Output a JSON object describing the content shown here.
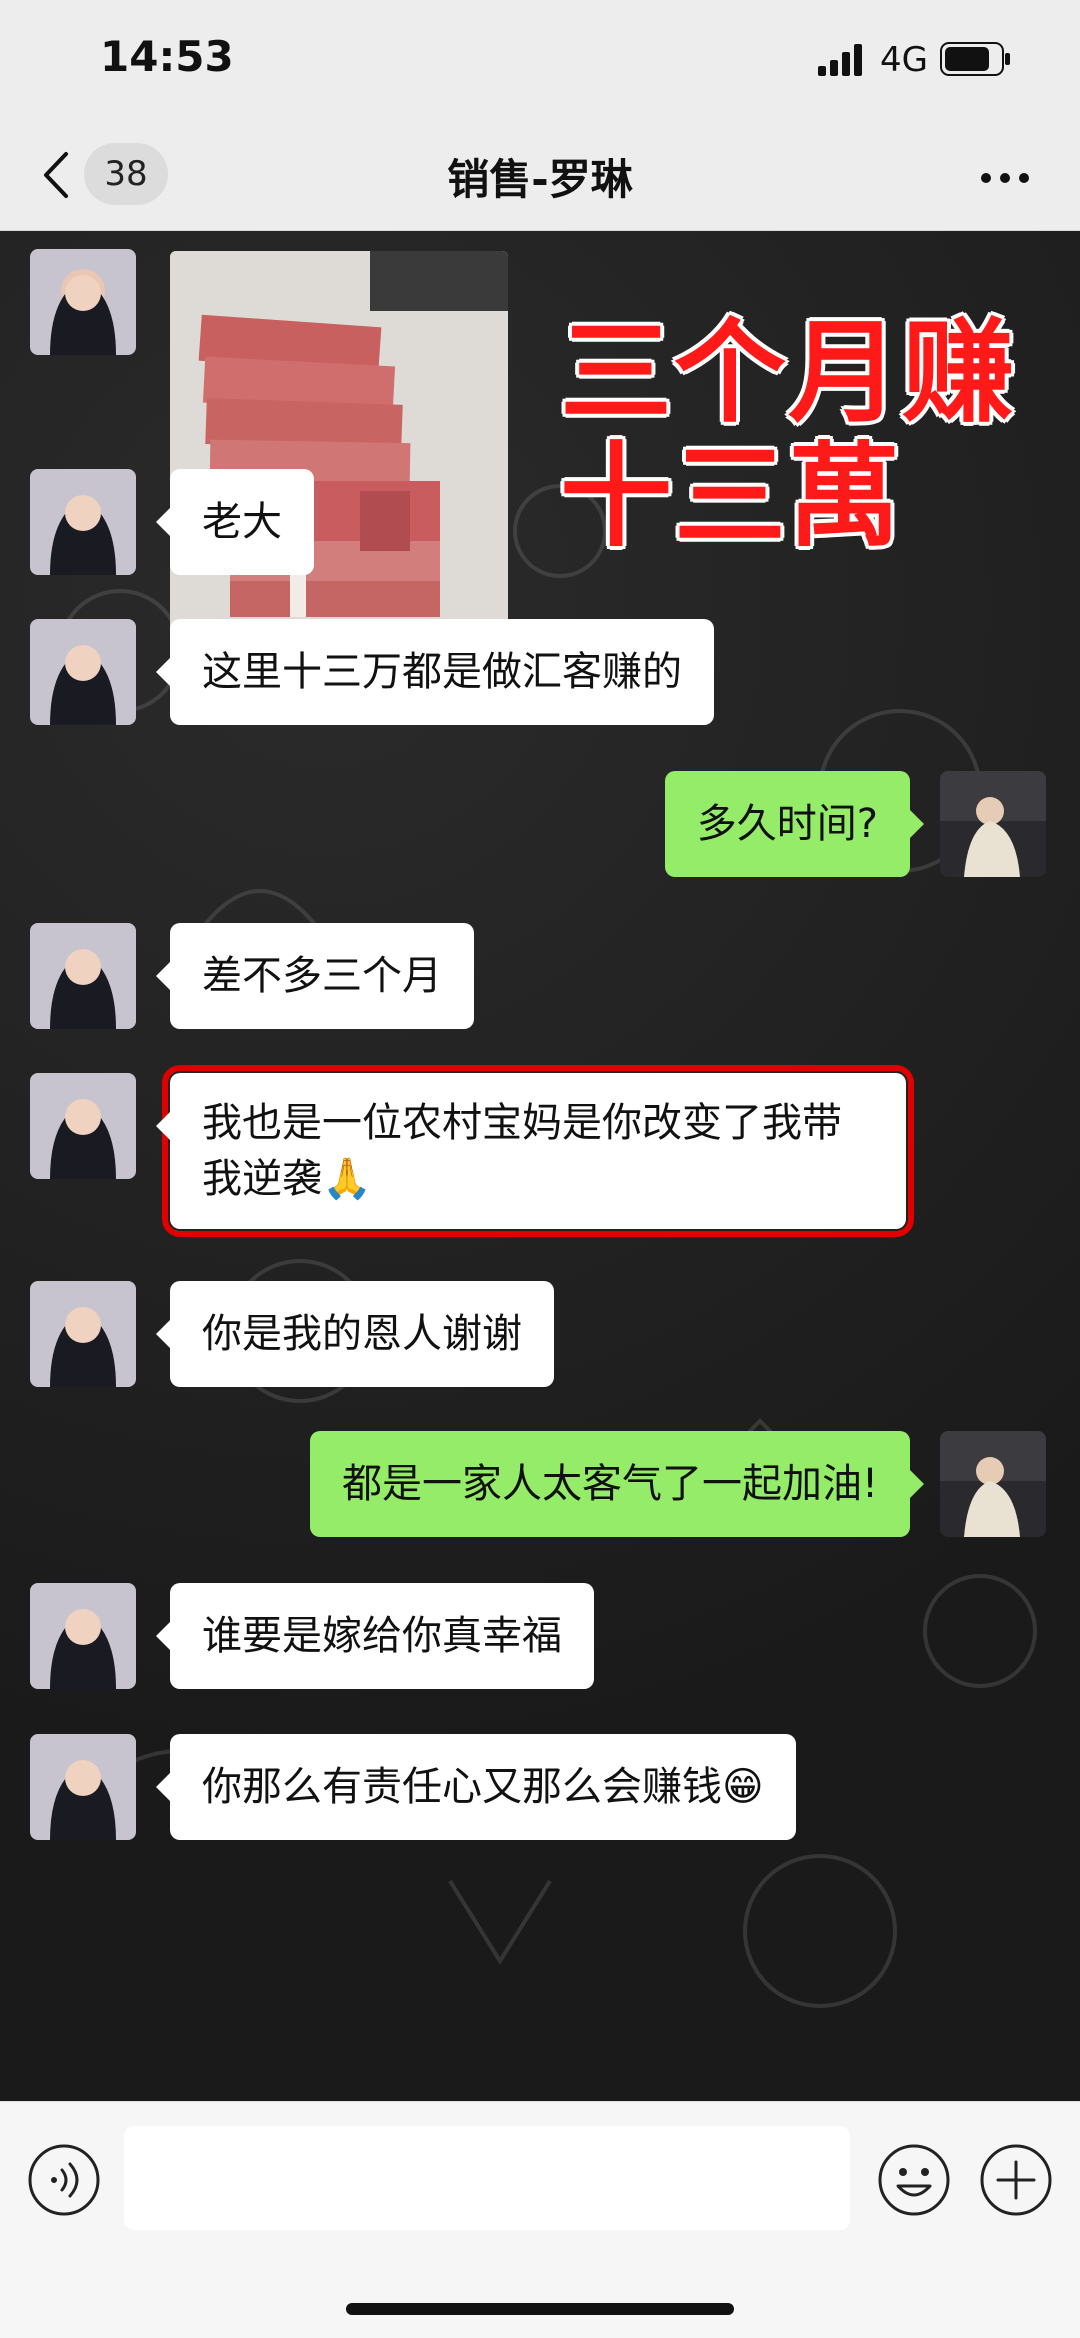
{
  "status_bar": {
    "time": "14:53",
    "network": "4G"
  },
  "nav": {
    "unread_count": "38",
    "title": "销售-罗琳"
  },
  "photo_overlay": {
    "line1": "三个月赚",
    "line2": "十三萬"
  },
  "messages": [
    {
      "side": "in",
      "text": "老大"
    },
    {
      "side": "in",
      "text": "这里十三万都是做汇客赚的"
    },
    {
      "side": "out",
      "text": "多久时间?"
    },
    {
      "side": "in",
      "text": "差不多三个月"
    },
    {
      "side": "in",
      "text": "我也是一位农村宝妈是你改变了我带我逆袭🙏",
      "highlighted": true
    },
    {
      "side": "in",
      "text": "你是我的恩人谢谢"
    },
    {
      "side": "out",
      "text": "都是一家人太客气了一起加油!"
    },
    {
      "side": "in",
      "text": "谁要是嫁给你真幸福"
    },
    {
      "side": "in",
      "text": "你那么有责任心又那么会赚钱😁"
    }
  ],
  "input": {
    "value": "",
    "placeholder": ""
  },
  "colors": {
    "outgoing_bubble": "#95ec69",
    "incoming_bubble": "#ffffff",
    "highlight": "#e00000",
    "overlay_text": "#ff1a1a"
  },
  "icons": [
    "back-icon",
    "more-icon",
    "voice-icon",
    "emoji-icon",
    "plus-icon"
  ]
}
